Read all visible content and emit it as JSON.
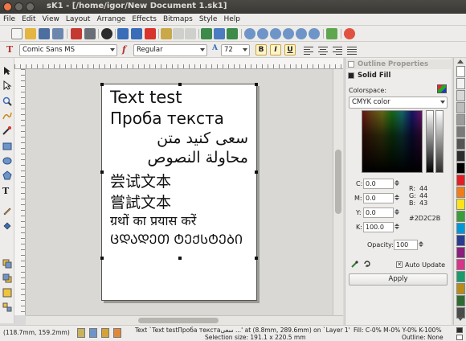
{
  "window": {
    "title": "sK1 - [/home/igor/New Document 1.sk1]"
  },
  "menu": [
    "File",
    "Edit",
    "View",
    "Layout",
    "Arrange",
    "Effects",
    "Bitmaps",
    "Style",
    "Help"
  ],
  "textbar": {
    "font_family": "Comic Sans MS",
    "font_style": "Regular",
    "font_size": "72",
    "bold_label": "B",
    "italic_label": "I",
    "underline_label": "U"
  },
  "document": {
    "lines": [
      "Text test",
      "Проба текста",
      "سعی کنید متن",
      "محاولة النصوص",
      "尝试文本",
      "嘗試文本",
      "ग्रथों का प्रयास करें",
      "ᲪᲓᲐᲓᲔᲗ ᲢᲔᲥᲡᲢᲔᲑᲘ"
    ]
  },
  "panels": {
    "outline_title": "Outline Properties",
    "fill_title": "Solid Fill",
    "colorspace_label": "Colorspace:",
    "colorspace_value": "CMYK color",
    "cmyk": {
      "c_label": "C:",
      "c": "0.0",
      "m_label": "M:",
      "m": "0.0",
      "y_label": "Y:",
      "y": "0.0",
      "k_label": "K:",
      "k": "100.0"
    },
    "rgb": {
      "r_label": "R:",
      "r": "44",
      "g_label": "G:",
      "g": "44",
      "b_label": "B:",
      "b": "43"
    },
    "hex": "#2D2C2B",
    "opacity_label": "Opacity:",
    "opacity": "100",
    "auto_update_label": "Auto Update",
    "auto_update": true,
    "apply_label": "Apply"
  },
  "palette_colors": [
    "#ffffff",
    "#f2f2f2",
    "#d8d8d8",
    "#bdbdbd",
    "#9b9b9b",
    "#7a7a7a",
    "#555555",
    "#2d2d2d",
    "#000000",
    "#e41d25",
    "#f07d1a",
    "#fde31a",
    "#3b9c3a",
    "#0097d7",
    "#2a3c8f",
    "#8b1f7d",
    "#d63589",
    "#1d9a6c",
    "#b88c1c",
    "#2f6a32",
    "#4b4b4b"
  ],
  "status": {
    "coords": "(118.7mm, 159.2mm)",
    "info1": "Text `Text testПроба текстаسعی ...' at (8.8mm, 289.6mm) on `Layer 1'",
    "fill_info": "Fill: C-0% M-0% Y-0% K-100%",
    "info2": "Selection size: 191.1 x 220.5 mm",
    "outline_info": "Outline: None"
  }
}
